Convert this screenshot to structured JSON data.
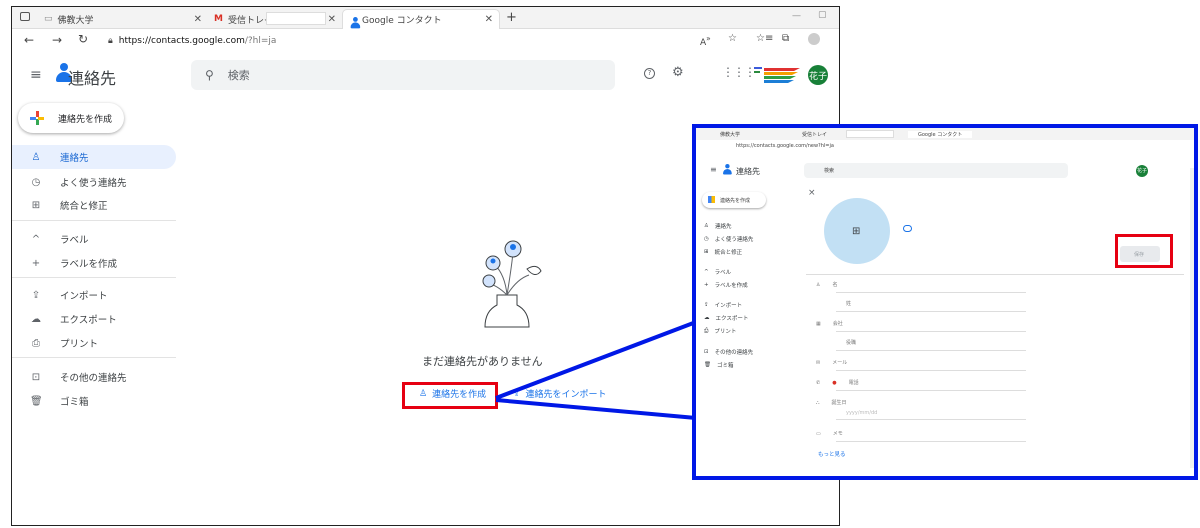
{
  "browser": {
    "tabs": [
      {
        "label": "佛教大学"
      },
      {
        "label": "受信トレイ -"
      },
      {
        "label": "Google コンタクト"
      }
    ],
    "new_tab": "+",
    "url_host": "https://contacts.google.com",
    "url_path": "/?hl=ja",
    "window_min": "—",
    "window_restore": "▢"
  },
  "app": {
    "title": "連絡先",
    "search_placeholder": "検索",
    "avatar_text": "花子",
    "create_label": "連絡先を作成"
  },
  "sidebar": {
    "items": [
      {
        "label": "連絡先",
        "icon": "person-icon"
      },
      {
        "label": "よく使う連絡先",
        "icon": "history-icon"
      },
      {
        "label": "統合と修正",
        "icon": "merge-icon"
      },
      {
        "label": "ラベル",
        "icon": "chevron-up-icon"
      },
      {
        "label": "ラベルを作成",
        "icon": "plus-icon"
      },
      {
        "label": "インポート",
        "icon": "upload-icon"
      },
      {
        "label": "エクスポート",
        "icon": "cloud-icon"
      },
      {
        "label": "プリント",
        "icon": "print-icon"
      },
      {
        "label": "その他の連絡先",
        "icon": "archive-icon"
      },
      {
        "label": "ゴミ箱",
        "icon": "trash-icon"
      }
    ]
  },
  "main": {
    "empty_text": "まだ連絡先がありません",
    "create_link": "連絡先を作成",
    "import_link": "連絡先をインポート"
  },
  "inset": {
    "tabs": [
      "佛教大学",
      "受信トレイ",
      "Google コンタクト"
    ],
    "url": "https://contacts.google.com/new?hl=ja",
    "title": "連絡先",
    "search": "検索",
    "avatar": "花子",
    "create": "連絡先を作成",
    "side": [
      "連絡先",
      "よく使う連絡先",
      "統合と修正",
      "ラベル",
      "ラベルを作成",
      "インポート",
      "エクスポート",
      "プリント",
      "その他の連絡先",
      "ゴミ箱"
    ],
    "close": "×",
    "save": "保存",
    "fields": [
      "名",
      "姓",
      "会社",
      "役職",
      "メール",
      "電話",
      "誕生日",
      "yyyy/mm/dd",
      "メモ"
    ],
    "more": "もっと見る"
  },
  "colors": {
    "accent": "#1a73e8",
    "annotation_red": "#e60012",
    "annotation_blue": "#0018e6",
    "active_bg": "#e8f0fe"
  }
}
